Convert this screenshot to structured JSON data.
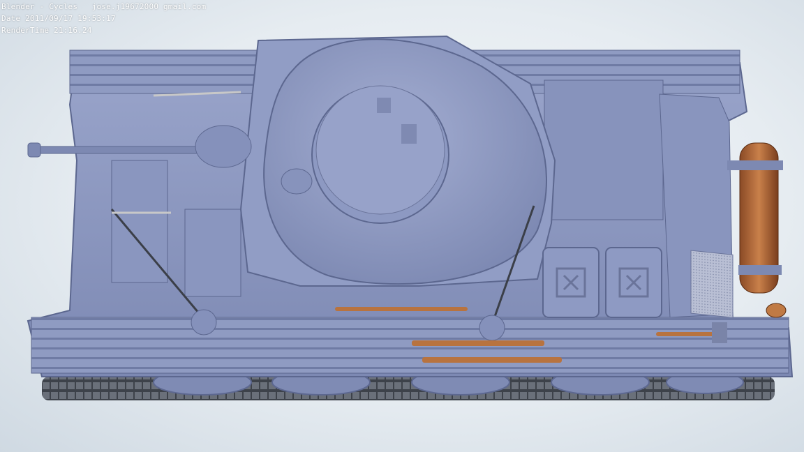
{
  "overlay": {
    "line1": "Blender - Cycles   jose.j19672000 gmail.com",
    "line2": "Date 2011/09/17 19:53:17",
    "line3": "RenderTime 21:16.24"
  },
  "colors": {
    "hull": "#8f9bc2",
    "hull_dark": "#6b779e",
    "hull_light": "#a9b3d6",
    "track": "#4a4f58",
    "exhaust": "#b56a3a",
    "wood": "#b8733f",
    "background": "#e9eef3"
  },
  "subject": {
    "icon": "tank-render"
  }
}
